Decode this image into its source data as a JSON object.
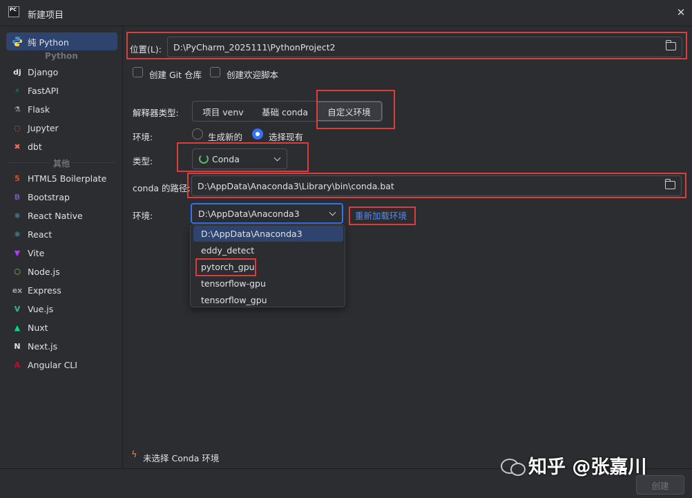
{
  "window": {
    "app_icon_text": "PC",
    "title": "新建项目",
    "close_glyph": "✕"
  },
  "sidebar": {
    "items_top": [
      {
        "label": "纯 Python",
        "icon": "python-icon",
        "glyph": "●",
        "color": "#4b8bbe"
      }
    ],
    "group_python": "Python",
    "items_python": [
      {
        "label": "Django",
        "icon": "django-icon",
        "glyph": "dj",
        "color": "#dfe1e5"
      },
      {
        "label": "FastAPI",
        "icon": "fastapi-icon",
        "glyph": "⚡",
        "color": "#05998b"
      },
      {
        "label": "Flask",
        "icon": "flask-icon",
        "glyph": "⚗",
        "color": "#9da0a8"
      },
      {
        "label": "Jupyter",
        "icon": "jupyter-icon",
        "glyph": "◌",
        "color": "#f37726"
      },
      {
        "label": "dbt",
        "icon": "dbt-icon",
        "glyph": "✖",
        "color": "#ff694b"
      }
    ],
    "group_other": "其他",
    "items_other": [
      {
        "label": "HTML5 Boilerplate",
        "icon": "html5-icon",
        "glyph": "5",
        "color": "#e44d26"
      },
      {
        "label": "Bootstrap",
        "icon": "bootstrap-icon",
        "glyph": "B",
        "color": "#7952b3"
      },
      {
        "label": "React Native",
        "icon": "react-native-icon",
        "glyph": "⚛",
        "color": "#61dafb"
      },
      {
        "label": "React",
        "icon": "react-icon",
        "glyph": "⚛",
        "color": "#61dafb"
      },
      {
        "label": "Vite",
        "icon": "vite-icon",
        "glyph": "▼",
        "color": "#bd34fe"
      },
      {
        "label": "Node.js",
        "icon": "nodejs-icon",
        "glyph": "⬡",
        "color": "#8cc84b"
      },
      {
        "label": "Express",
        "icon": "express-icon",
        "glyph": "ex",
        "color": "#9da0a8"
      },
      {
        "label": "Vue.js",
        "icon": "vue-icon",
        "glyph": "V",
        "color": "#41b883"
      },
      {
        "label": "Nuxt",
        "icon": "nuxt-icon",
        "glyph": "▲",
        "color": "#00dc82"
      },
      {
        "label": "Next.js",
        "icon": "nextjs-icon",
        "glyph": "N",
        "color": "#dfe1e5"
      },
      {
        "label": "Angular CLI",
        "icon": "angular-icon",
        "glyph": "A",
        "color": "#dd0031"
      }
    ]
  },
  "location": {
    "label": "位置(L):",
    "value": "D:\\PyCharm_2025111\\PythonProject2"
  },
  "options": {
    "git_label": "创建 Git 仓库",
    "welcome_label": "创建欢迎脚本"
  },
  "interpreter": {
    "label": "解释器类型:",
    "tabs": [
      "项目 venv",
      "基础 conda",
      "自定义环境"
    ],
    "active_tab": 2
  },
  "environment_mode": {
    "label": "环境:",
    "option_new": "生成新的",
    "option_existing": "选择现有"
  },
  "type": {
    "label": "类型:",
    "value": "Conda"
  },
  "conda_path": {
    "label": "conda 的路径:",
    "value": "D:\\AppData\\Anaconda3\\Library\\bin\\conda.bat"
  },
  "env_select": {
    "label": "环境:",
    "value": "D:\\AppData\\Anaconda3",
    "reload_link": "重新加载环境",
    "options": [
      "D:\\AppData\\Anaconda3",
      "eddy_detect",
      "pytorch_gpu",
      "tensorflow-gpu",
      "tensorflow_gpu"
    ],
    "selected_index": 0
  },
  "warning": {
    "text": "未选择 Conda 环境"
  },
  "footer": {
    "create_label": "创建"
  },
  "watermark": {
    "text": "知乎 @张嘉川"
  },
  "colors": {
    "accent": "#3574f0",
    "highlight": "#e03c3c",
    "link": "#548af7"
  }
}
